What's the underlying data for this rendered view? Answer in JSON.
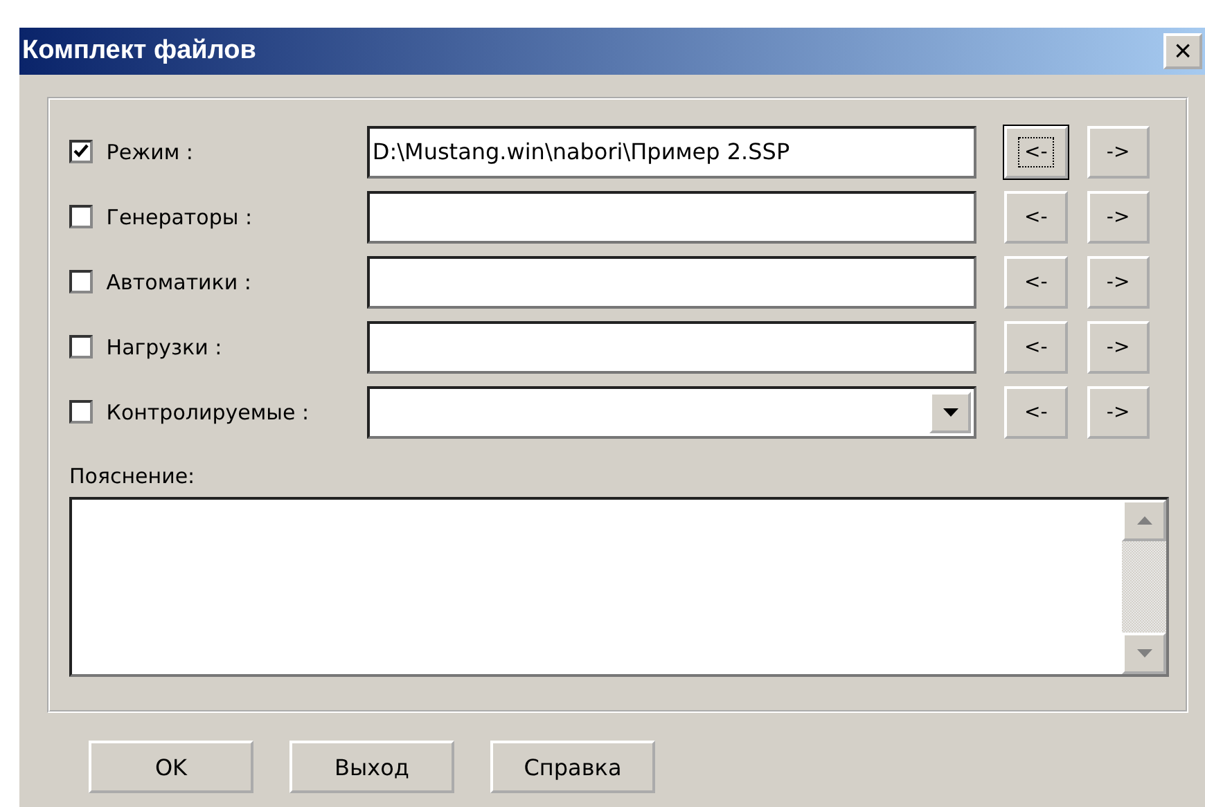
{
  "window": {
    "title": "Комплект файлов",
    "close": "×"
  },
  "rows": [
    {
      "kind": "text",
      "label": "Режим :",
      "checked": true,
      "value": "D:\\Mustang.win\\nabori\\Пример 2.SSP",
      "left": "<-",
      "right": "->",
      "focused": true
    },
    {
      "kind": "text",
      "label": "Генераторы :",
      "checked": false,
      "left": "<-",
      "right": "->",
      "focused": false
    },
    {
      "kind": "text",
      "label": "Автоматики :",
      "checked": false,
      "left": "<-",
      "right": "->",
      "focused": false
    },
    {
      "kind": "text",
      "label": "Нагрузки :",
      "checked": false,
      "left": "<-",
      "right": "->",
      "focused": false
    },
    {
      "kind": "dropdown",
      "label": "Контролируемые :",
      "checked": false,
      "left": "<-",
      "right": "->",
      "focused": false
    }
  ],
  "comment": {
    "label": "Пояснение:"
  },
  "buttons": [
    "OK",
    "Выход",
    "Справка"
  ]
}
